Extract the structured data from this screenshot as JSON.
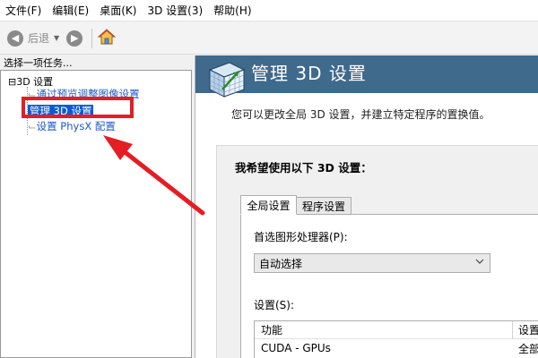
{
  "menu": [
    "文件(F)",
    "编辑(E)",
    "桌面(K)",
    "3D 设置(3)",
    "帮助(H)"
  ],
  "toolbar": {
    "back_label": "后退"
  },
  "left_panel": {
    "task_label": "选择一项任务...",
    "tree_root": "3D 设置",
    "items": [
      "通过预览调整图像设置",
      "管理 3D 设置",
      "设置 PhysX 配置"
    ]
  },
  "banner": {
    "title": "管理 3D 设置"
  },
  "description": "您可以更改全局 3D 设置，并建立特定程序的置换值。 ",
  "group": {
    "title": "我希望使用以下 3D 设置：",
    "tabs": [
      "全局设置",
      "程序设置"
    ],
    "gpu_label": "首选图形处理器(P):",
    "gpu_value": "自动选择",
    "settings_label": "设置(S):",
    "table": {
      "headers": [
        "功能",
        "设置"
      ],
      "rows": [
        [
          "CUDA - GPUs",
          "全部"
        ]
      ]
    }
  },
  "colors": {
    "banner": "#3f6a8c",
    "link": "#1e58c9",
    "selection": "#0b5bd7",
    "annotation_red": "#e31e24"
  }
}
